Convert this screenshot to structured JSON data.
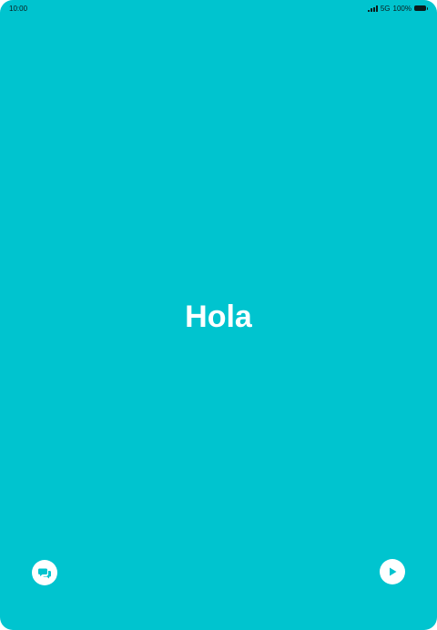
{
  "status_bar": {
    "time": "10:00",
    "network": "5G",
    "battery": "100%"
  },
  "main": {
    "greeting": "Hola"
  },
  "controls": {
    "left_icon": "chat-bubbles-icon",
    "right_icon": "play-icon"
  },
  "colors": {
    "background": "#00c4cf",
    "foreground": "#ffffff",
    "status_text": "#0b1b1c"
  }
}
